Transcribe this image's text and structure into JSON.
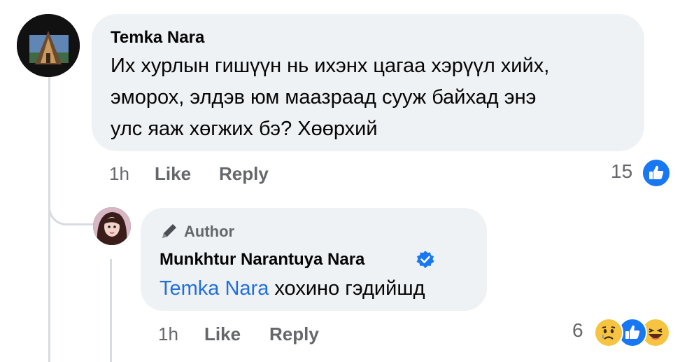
{
  "comment": {
    "author": "Temka Nara",
    "text_lines": [
      "Их хурлын гишүүн нь ихэнх цагаа хэрүүл хийх,",
      "эморох, элдэв юм маазраад сууж байхад энэ",
      "улс яаж хөгжих бэ? Хөөрхий"
    ],
    "time": "1h",
    "like_label": "Like",
    "reply_label": "Reply",
    "reaction_count": "15",
    "reactions": [
      "like-reaction-icon"
    ]
  },
  "reply": {
    "badge_label": "Author",
    "author": "Munkhtur Narantuya Nara",
    "verified": true,
    "mention": "Temka Nara",
    "text": " хохино гэдийшд",
    "time": "1h",
    "like_label": "Like",
    "reply_label": "Reply",
    "reaction_count": "6",
    "reactions": [
      "sad-reaction-icon",
      "like-reaction-icon",
      "haha-reaction-icon"
    ]
  },
  "colors": {
    "bubble": "#eff2f5",
    "link": "#216fdb",
    "meta": "#65676b",
    "like_blue": "#1877f2"
  }
}
